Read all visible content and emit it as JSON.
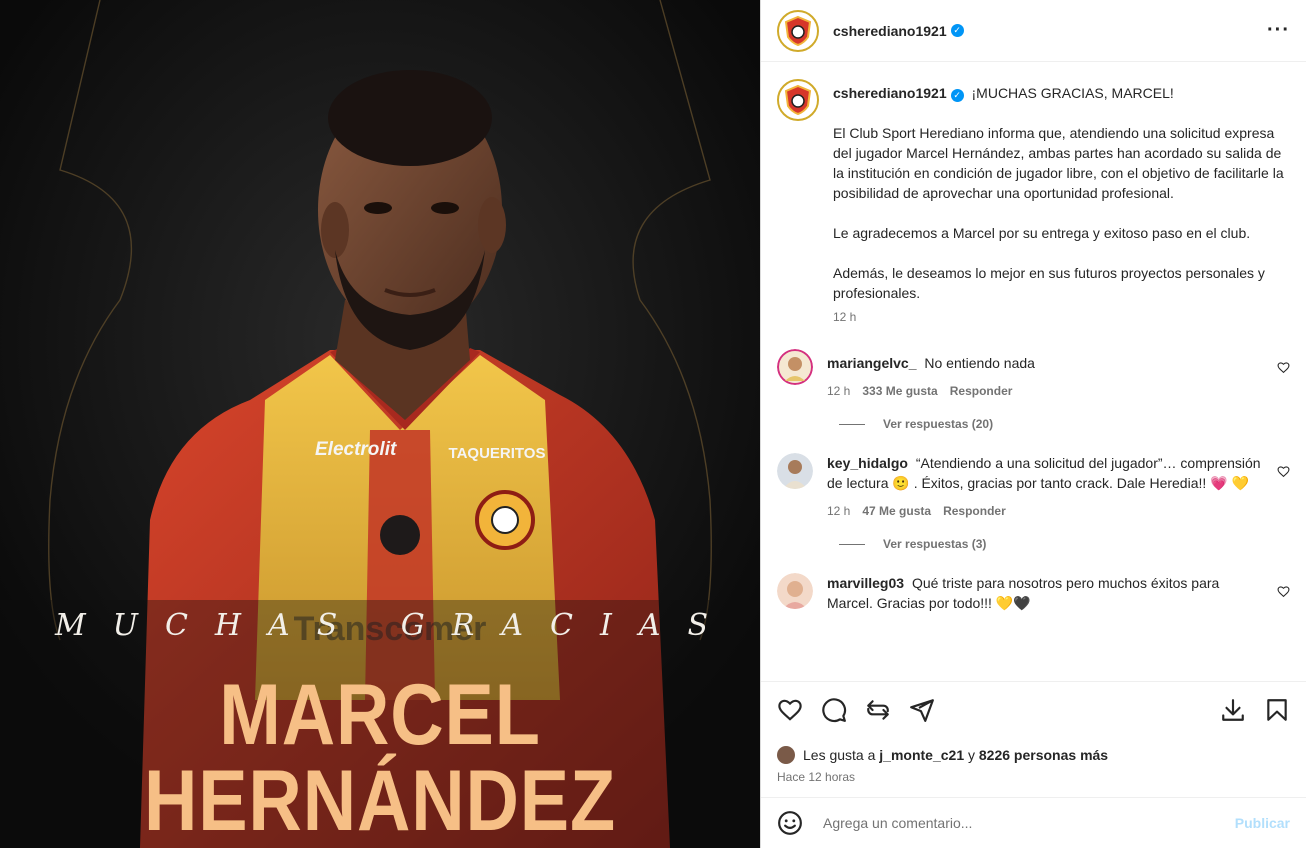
{
  "post_image": {
    "pretitle": "MUCHAS GRACIAS",
    "name": "MARCEL HERNÁNDEZ",
    "jersey_sponsor_left": "Electrolit",
    "jersey_sponsor_right": "TAQUERITOS",
    "jersey_front_text": "Transcomer",
    "colors": {
      "background": "#0d0d0d",
      "name_color": "#f6bf86",
      "jersey_red": "#c9302a",
      "jersey_yellow": "#e7b93d"
    }
  },
  "header": {
    "username": "csherediano1921",
    "verified": true,
    "more_icon": "more-horizontal-icon"
  },
  "caption": {
    "username": "csherediano1921",
    "headline": "¡MUCHAS GRACIAS, MARCEL!",
    "paragraphs": [
      "El Club Sport Herediano informa que, atendiendo una solicitud expresa del jugador Marcel Hernández, ambas partes han acordado su salida de la institución en condición de jugador libre, con el objetivo de facilitarle la posibilidad de aprovechar una oportunidad profesional.",
      "Le agradecemos a Marcel por su entrega y exitoso paso en el club.",
      "Además, le deseamos lo mejor en sus futuros proyectos personales y profesionales."
    ],
    "time": "12 h"
  },
  "comments": [
    {
      "username": "mariangelvc_",
      "text": "No entiendo nada",
      "time": "12 h",
      "likes": "333 Me gusta",
      "reply": "Responder",
      "view_replies": "Ver respuestas (20)"
    },
    {
      "username": "key_hidalgo",
      "text": "“Atendiendo a una solicitud del jugador”… comprensión de lectura 🙂 . Éxitos, gracias por tanto crack. Dale Heredia!! 💗 💛",
      "time": "12 h",
      "likes": "47 Me gusta",
      "reply": "Responder",
      "view_replies": "Ver respuestas (3)"
    },
    {
      "username": "marvilleg03",
      "text": "Qué triste para nosotros pero muchos éxitos para Marcel. Gracias por todo!!! 💛🖤",
      "time": "",
      "likes": "",
      "reply": "",
      "view_replies": ""
    }
  ],
  "actions": {
    "icons": [
      "heart-icon",
      "comment-icon",
      "repost-icon",
      "share-icon",
      "download-icon",
      "bookmark-icon"
    ],
    "likes_prefix": "Les gusta a",
    "liked_by": "j_monte_c21",
    "likes_mid": "y",
    "likes_count": "8226 personas más",
    "time_ago": "Hace 12 horas"
  },
  "add_comment": {
    "placeholder": "Agrega un comentario...",
    "publish": "Publicar"
  }
}
